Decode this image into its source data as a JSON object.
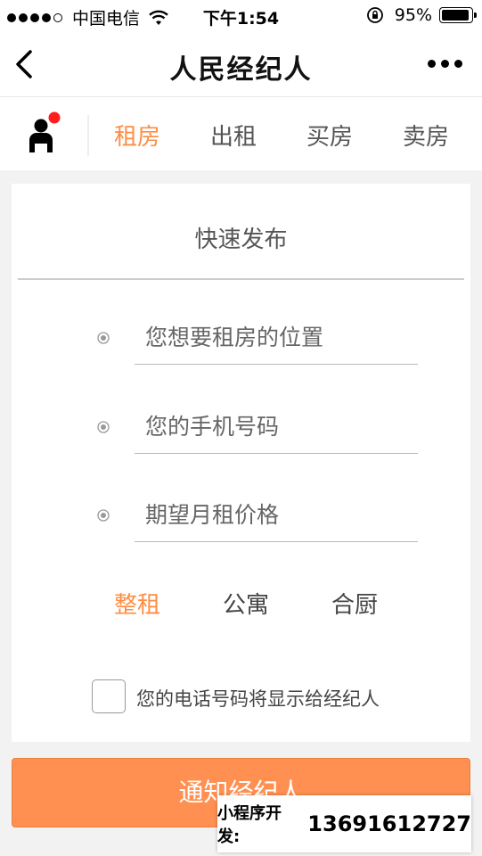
{
  "status_bar": {
    "carrier": "中国电信",
    "time": "下午1:54",
    "battery_percent": "95%",
    "battery_level": 0.95,
    "signal_bars": 4
  },
  "nav": {
    "title": "人民经纪人"
  },
  "tabs": [
    {
      "label": "租房",
      "active": true
    },
    {
      "label": "出租",
      "active": false
    },
    {
      "label": "买房",
      "active": false
    },
    {
      "label": "卖房",
      "active": false
    }
  ],
  "form": {
    "title": "快速发布",
    "fields": [
      {
        "placeholder": "您想要租房的位置",
        "value": ""
      },
      {
        "placeholder": "您的手机号码",
        "value": ""
      },
      {
        "placeholder": "期望月租价格",
        "value": ""
      }
    ],
    "rent_types": [
      {
        "label": "整租",
        "active": true
      },
      {
        "label": "公寓",
        "active": false
      },
      {
        "label": "合厨",
        "active": false
      }
    ],
    "consent_label": "您的电话号码将显示给经纪人",
    "consent_checked": false
  },
  "submit_label": "通知经纪人",
  "watermark": {
    "label": "小程序开发:",
    "phone": "13691612727"
  },
  "colors": {
    "accent": "#ff8c42",
    "button": "#ff9052",
    "notification_dot": "#ff1e1e"
  },
  "icons": [
    "back-arrow-icon",
    "more-dots-icon",
    "user-icon",
    "radio-target-icon",
    "wifi-icon",
    "orientation-lock-icon",
    "battery-icon"
  ]
}
